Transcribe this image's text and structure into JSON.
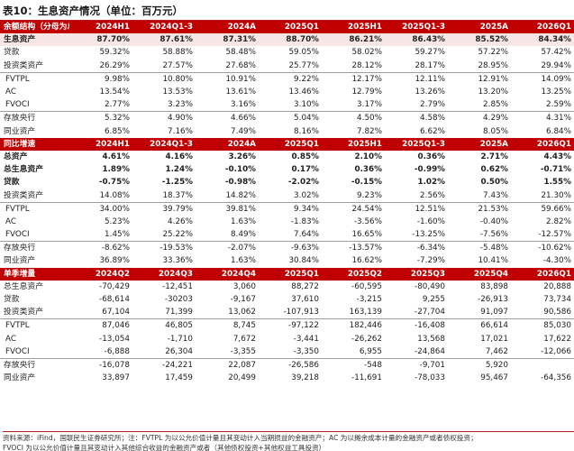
{
  "title": "表10：生息资产情况（单位：百万元）",
  "sections": [
    {
      "header_label": "余额结构（分母为总资产）",
      "columns": [
        "2024H1",
        "2024Q1-3",
        "2024A",
        "2025Q1",
        "2025H1",
        "2025Q1-3",
        "2025A",
        "2026Q1"
      ],
      "rows": [
        {
          "label": "生息资产",
          "values": [
            "87.70%",
            "87.61%",
            "87.31%",
            "88.70%",
            "86.21%",
            "86.43%",
            "85.52%",
            "84.34%"
          ]
        },
        {
          "label": "贷款",
          "values": [
            "59.32%",
            "58.88%",
            "58.48%",
            "59.05%",
            "58.02%",
            "59.27%",
            "57.22%",
            "57.42%"
          ]
        },
        {
          "label": "投资类资产",
          "values": [
            "26.29%",
            "27.57%",
            "27.68%",
            "25.77%",
            "28.12%",
            "28.17%",
            "28.95%",
            "29.94%"
          ]
        },
        {
          "label": "FVTPL",
          "values": [
            "9.98%",
            "10.80%",
            "10.91%",
            "9.22%",
            "12.17%",
            "12.11%",
            "12.91%",
            "14.09%"
          ]
        },
        {
          "label": "AC",
          "values": [
            "13.54%",
            "13.53%",
            "13.61%",
            "13.46%",
            "12.79%",
            "13.26%",
            "13.20%",
            "13.25%"
          ]
        },
        {
          "label": "FVOCI",
          "values": [
            "2.77%",
            "3.23%",
            "3.16%",
            "3.10%",
            "3.17%",
            "2.79%",
            "2.85%",
            "2.59%"
          ]
        },
        {
          "label": "存放央行",
          "values": [
            "5.32%",
            "4.90%",
            "4.66%",
            "5.04%",
            "4.50%",
            "4.58%",
            "4.29%",
            "4.31%"
          ]
        },
        {
          "label": "同业资产",
          "values": [
            "6.85%",
            "7.16%",
            "7.49%",
            "8.16%",
            "7.82%",
            "6.62%",
            "8.05%",
            "6.84%"
          ]
        }
      ]
    },
    {
      "header_label": "同比增速",
      "columns": [
        "2024H1",
        "2024Q1-3",
        "2024A",
        "2025Q1",
        "2025H1",
        "2025Q1-3",
        "2025A",
        "2026Q1"
      ],
      "rows": [
        {
          "label": "总资产",
          "values": [
            "4.61%",
            "4.16%",
            "3.26%",
            "0.85%",
            "2.10%",
            "0.36%",
            "2.71%",
            "4.43%"
          ]
        },
        {
          "label": "总生息资产",
          "values": [
            "1.89%",
            "1.24%",
            "-0.10%",
            "0.17%",
            "0.36%",
            "-0.99%",
            "0.62%",
            "-0.71%"
          ]
        },
        {
          "label": "贷款",
          "values": [
            "-0.75%",
            "-1.25%",
            "-0.98%",
            "-2.02%",
            "-0.15%",
            "1.02%",
            "0.50%",
            "1.55%"
          ]
        },
        {
          "label": "投资类资产",
          "values": [
            "14.08%",
            "18.37%",
            "14.82%",
            "3.02%",
            "9.23%",
            "2.56%",
            "7.43%",
            "21.30%"
          ]
        },
        {
          "label": "FVTPL",
          "values": [
            "34.00%",
            "39.79%",
            "39.81%",
            "9.34%",
            "24.54%",
            "12.51%",
            "21.53%",
            "59.66%"
          ]
        },
        {
          "label": "AC",
          "values": [
            "5.23%",
            "4.26%",
            "1.63%",
            "-1.83%",
            "-3.56%",
            "-1.60%",
            "-0.40%",
            "2.82%"
          ]
        },
        {
          "label": "FVOCI",
          "values": [
            "1.45%",
            "25.22%",
            "8.49%",
            "7.64%",
            "16.65%",
            "-13.25%",
            "-7.56%",
            "-12.57%"
          ]
        },
        {
          "label": "存放央行",
          "values": [
            "-8.62%",
            "-19.53%",
            "-2.07%",
            "-9.63%",
            "-13.57%",
            "-6.34%",
            "-5.48%",
            "-10.62%"
          ]
        },
        {
          "label": "同业资产",
          "values": [
            "36.89%",
            "33.36%",
            "1.63%",
            "30.84%",
            "16.62%",
            "-7.29%",
            "10.41%",
            "-4.30%"
          ]
        }
      ]
    },
    {
      "header_label": "单季增量",
      "columns": [
        "2024Q2",
        "2024Q3",
        "2024Q4",
        "2025Q1",
        "2025Q2",
        "2025Q3",
        "2025Q4",
        "2026Q1"
      ],
      "rows": [
        {
          "label": "总生息资产",
          "values": [
            "-70,429",
            "-12,451",
            "3,060",
            "88,272",
            "-60,595",
            "-80,490",
            "83,898",
            "20,888"
          ]
        },
        {
          "label": "贷款",
          "values": [
            "-68,614",
            "-30203",
            "-9,167",
            "37,610",
            "-3,215",
            "9,255",
            "-26,913",
            "73,734"
          ]
        },
        {
          "label": "投资类资产",
          "values": [
            "67,104",
            "71,399",
            "13,062",
            "-107,913",
            "163,139",
            "-27,704",
            "91,097",
            "90,586"
          ]
        },
        {
          "label": "FVTPL",
          "values": [
            "87,046",
            "46,805",
            "8,745",
            "-97,122",
            "182,446",
            "-16,408",
            "66,614",
            "85,030"
          ]
        },
        {
          "label": "AC",
          "values": [
            "-13,054",
            "-1,710",
            "7,672",
            "-3,441",
            "-26,262",
            "13,568",
            "17,021",
            "17,622"
          ]
        },
        {
          "label": "FVOCI",
          "values": [
            "-6,888",
            "26,304",
            "-3,355",
            "-3,350",
            "6,955",
            "-24,864",
            "7,462",
            "-12,066"
          ]
        },
        {
          "label": "存放央行",
          "values": [
            "-16,078",
            "-24,221",
            "22,087",
            "-26,586",
            "-548",
            "-9,701",
            "5,920",
            ""
          ]
        },
        {
          "label": "同业资产",
          "values": [
            "33,897",
            "17,459",
            "20,499",
            "39,218",
            "-11,691",
            "-78,033",
            "95,467",
            "-64,356"
          ]
        }
      ]
    }
  ],
  "footer": {
    "line1": "资料来源：iFind，国联民生证券研究所；注：FVTPL 为以公允价值计量且其变动计入当期损益的金融资产；AC 为以摊余成本计量的金融资产或者债权投资；",
    "line2": "FVOCI 为以公允价值计量且其变动计入其他综合收益的金融资产或者（其他债权投资+其他权益工具投资）"
  },
  "colors": {
    "header_bg": "#c00000",
    "header_text": "#ffffff",
    "shade_bg": "#f7e6e6",
    "title_rule": "#b71c1c"
  }
}
